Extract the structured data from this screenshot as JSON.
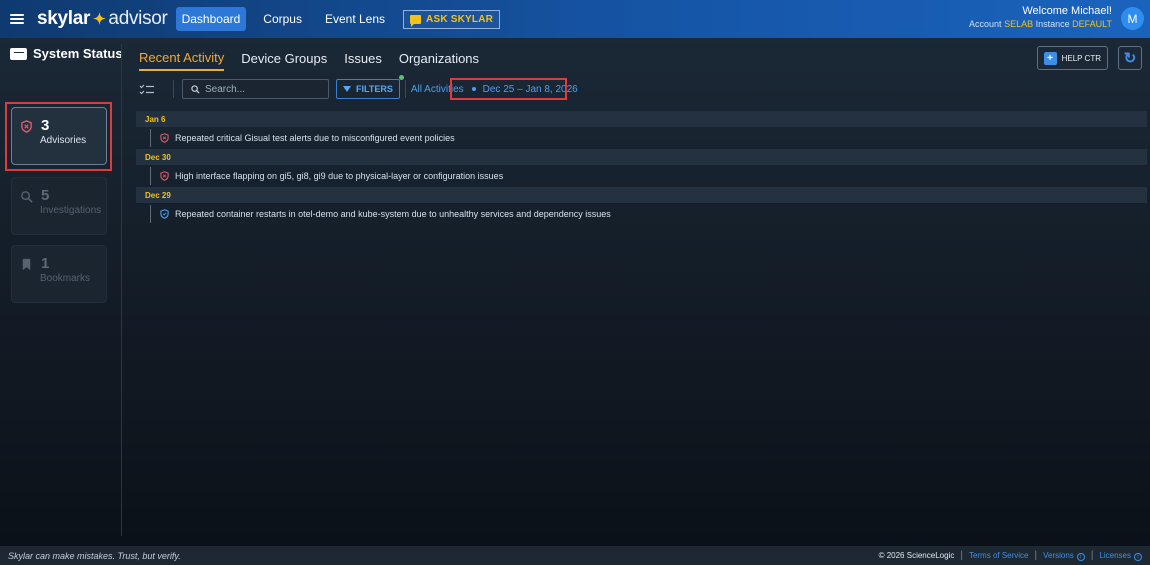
{
  "topbar": {
    "logo_brand": "skylar",
    "logo_product": "advisor",
    "nav": [
      "Dashboard",
      "Corpus",
      "Event Lens"
    ],
    "ask_label": "ASK SKYLAR",
    "welcome": "Welcome Michael!",
    "account_label": "Account",
    "account_value": "SELAB",
    "instance_label": "Instance",
    "instance_value": "DEFAULT",
    "avatar_initial": "M"
  },
  "sidebar": {
    "title": "System Status",
    "cards": [
      {
        "count": "3",
        "label": "Advisories"
      },
      {
        "count": "5",
        "label": "Investigations"
      },
      {
        "count": "1",
        "label": "Bookmarks"
      }
    ]
  },
  "tabs": [
    "Recent Activity",
    "Device Groups",
    "Issues",
    "Organizations"
  ],
  "help_label": "HELP CTR",
  "toolbar": {
    "search_placeholder": "Search...",
    "filters_label": "FILTERS",
    "all_activities": "All Activities",
    "date_range": "Dec 25 – Jan 8, 2026"
  },
  "timeline": [
    {
      "date": "Jan 6",
      "items": [
        "Repeated critical Gisual test alerts due to misconfigured event policies"
      ]
    },
    {
      "date": "Dec 30",
      "items": [
        "High interface flapping on gi5, gi8, gi9 due to physical-layer or configuration issues"
      ]
    },
    {
      "date": "Dec 29",
      "items": [
        "Repeated container restarts in otel-demo and kube-system due to unhealthy services and dependency issues"
      ]
    }
  ],
  "footer": {
    "disclaimer": "Skylar can make mistakes. Trust, but verify.",
    "copyright": "© 2026 ScienceLogic",
    "links": [
      "Terms of Service",
      "Versions",
      "Licenses"
    ]
  },
  "colors": {
    "accent": "#f2a93b",
    "highlight": "#e03b3b",
    "link": "#4f9ff0",
    "brand_blue": "#1656a8"
  }
}
